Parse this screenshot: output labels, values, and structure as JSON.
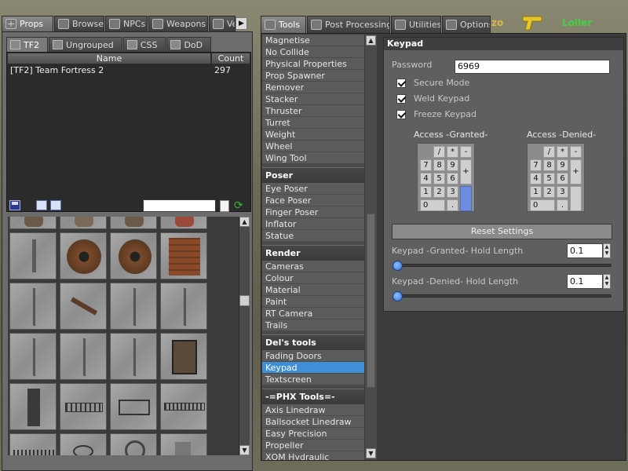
{
  "hud": {
    "left_text": "zo",
    "right_text": "Loller"
  },
  "props_panel": {
    "tabs": [
      "Props",
      "Browse",
      "NPCs",
      "Weapons",
      "Ve"
    ],
    "subtabs": [
      "TF2",
      "Ungrouped",
      "CSS",
      "DoD"
    ],
    "list": {
      "columns": [
        "Name",
        "Count"
      ],
      "rows": [
        {
          "name": "[TF2] Team Fortress 2",
          "count": "297"
        }
      ]
    },
    "search_value": ""
  },
  "tools_panel": {
    "tabs": [
      "Tools",
      "Post Processing",
      "Utilities",
      "Options"
    ],
    "groups": [
      {
        "category": "",
        "items": [
          "Magnetise",
          "No Collide",
          "Physical Properties",
          "Prop Spawner",
          "Remover",
          "Stacker",
          "Thruster",
          "Turret",
          "Weight",
          "Wheel",
          "Wing Tool"
        ]
      },
      {
        "category": "Poser",
        "items": [
          "Eye Poser",
          "Face Poser",
          "Finger Poser",
          "Inflator",
          "Statue"
        ]
      },
      {
        "category": "Render",
        "items": [
          "Cameras",
          "Colour",
          "Material",
          "Paint",
          "RT Camera",
          "Trails"
        ]
      },
      {
        "category": "Del's tools",
        "items": [
          "Fading Doors",
          "Keypad",
          "Textscreen"
        ]
      },
      {
        "category": "-=PHX Tools=-",
        "items": [
          "Axis Linedraw",
          "Ballsocket Linedraw",
          "Easy Precision",
          "Propeller",
          "XQM Hydraulic"
        ]
      }
    ],
    "selected": "Keypad"
  },
  "keypad_panel": {
    "title": "Keypad",
    "password_label": "Password",
    "password_value": "6969",
    "checkboxes": [
      {
        "label": "Secure Mode",
        "checked": true
      },
      {
        "label": "Weld Keypad",
        "checked": true
      },
      {
        "label": "Freeze Keypad",
        "checked": true
      }
    ],
    "granted_label": "Access -Granted-",
    "denied_label": "Access -Denied-",
    "keys": [
      "/",
      "*",
      "-",
      "7",
      "8",
      "9",
      "+",
      "4",
      "5",
      "6",
      "1",
      "2",
      "3",
      "0",
      "."
    ],
    "reset_label": "Reset Settings",
    "granted_hold_label": "Keypad -Granted- Hold Length",
    "granted_hold_value": "0.1",
    "denied_hold_label": "Keypad -Denied- Hold Length",
    "denied_hold_value": "0.1"
  }
}
